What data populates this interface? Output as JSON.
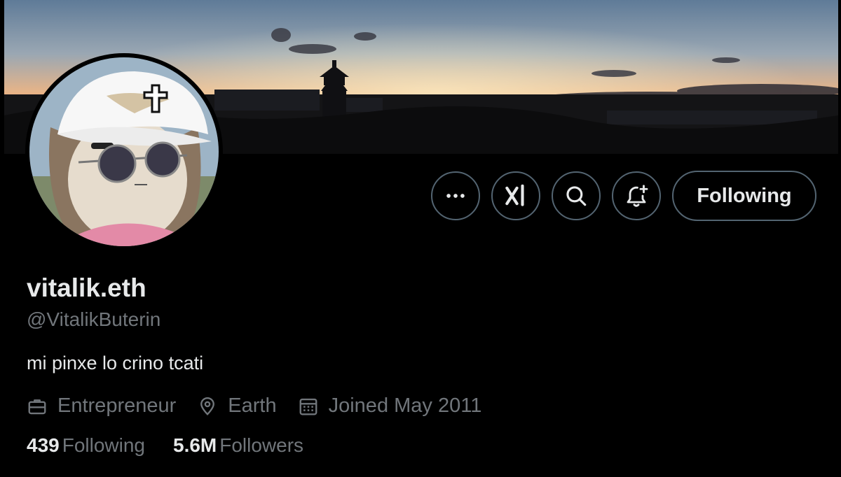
{
  "profile": {
    "display_name": "vitalik.eth",
    "handle": "@VitalikButerin",
    "bio": "mi pinxe lo crino tcati",
    "profession": "Entrepreneur",
    "location": "Earth",
    "joined": "Joined May 2011"
  },
  "stats": {
    "following_count": "439",
    "following_label": "Following",
    "followers_count": "5.6M",
    "followers_label": "Followers"
  },
  "actions": {
    "more_icon": "more-dots-icon",
    "grok_icon": "grok-icon",
    "search_icon": "search-icon",
    "notify_icon": "bell-plus-icon",
    "follow_label": "Following"
  },
  "colors": {
    "background": "#000000",
    "primary_text": "#e7e9ea",
    "secondary_text": "#71767b",
    "button_border": "#536471"
  }
}
